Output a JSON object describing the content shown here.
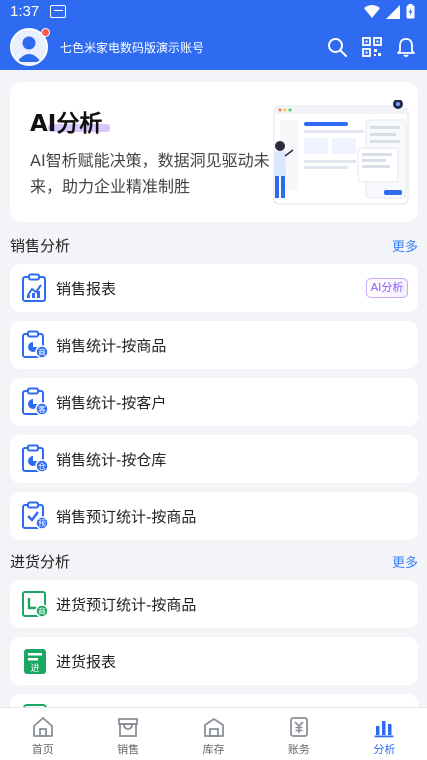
{
  "status_bar": {
    "time": "1:37"
  },
  "header": {
    "account_name": "七色米家电数码版演示账号"
  },
  "banner": {
    "title": "AI分析",
    "description": "AI智析赋能决策，数据洞见驱动未来，助力企业精准制胜"
  },
  "sections": [
    {
      "title": "销售分析",
      "more": "更多",
      "items": [
        {
          "label": "销售报表",
          "badge": "AI分析",
          "icon": "sales-report-icon"
        },
        {
          "label": "销售统计-按商品",
          "icon": "sales-by-product-icon",
          "sub": "商"
        },
        {
          "label": "销售统计-按客户",
          "icon": "sales-by-customer-icon",
          "sub": "客"
        },
        {
          "label": "销售统计-按仓库",
          "icon": "sales-by-warehouse-icon",
          "sub": "仓"
        },
        {
          "label": "销售预订统计-按商品",
          "icon": "sales-order-by-product-icon",
          "sub": "预"
        }
      ]
    },
    {
      "title": "进货分析",
      "more": "更多",
      "items": [
        {
          "label": "进货预订统计-按商品",
          "icon": "purchase-order-by-product-icon",
          "sub": "商"
        },
        {
          "label": "进货报表",
          "icon": "purchase-report-icon",
          "sub": "进"
        }
      ]
    }
  ],
  "nav": [
    {
      "label": "首页",
      "icon": "home-icon"
    },
    {
      "label": "销售",
      "icon": "sales-icon"
    },
    {
      "label": "库存",
      "icon": "inventory-icon"
    },
    {
      "label": "账务",
      "icon": "finance-icon"
    },
    {
      "label": "分析",
      "icon": "analysis-icon",
      "active": true
    }
  ],
  "colors": {
    "primary": "#2f6bf1",
    "sales_icon": "#2f6bf1",
    "purchase_icon": "#1aa763",
    "more_link": "#3b82f6"
  }
}
